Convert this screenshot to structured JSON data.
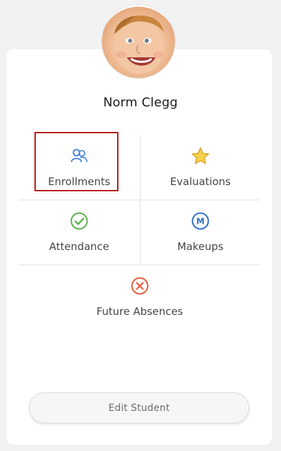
{
  "student": {
    "name": "Norm Clegg"
  },
  "menu": {
    "enrollments": {
      "label": "Enrollments",
      "icon": "people-icon",
      "color": "#3a7bd5",
      "selected": true
    },
    "evaluations": {
      "label": "Evaluations",
      "icon": "star-icon",
      "color": "#f2c22d"
    },
    "attendance": {
      "label": "Attendance",
      "icon": "check-circle-icon",
      "color": "#5bb04c"
    },
    "makeups": {
      "label": "Makeups",
      "icon": "m-circle-icon",
      "color": "#2f6fc6"
    },
    "future_absences": {
      "label": "Future Absences",
      "icon": "x-circle-icon",
      "color": "#ea5b3d"
    }
  },
  "actions": {
    "edit_student": "Edit Student"
  },
  "colors": {
    "selection_border": "#b51a1a",
    "card_bg": "#ffffff",
    "page_bg": "#f2f2f2"
  }
}
